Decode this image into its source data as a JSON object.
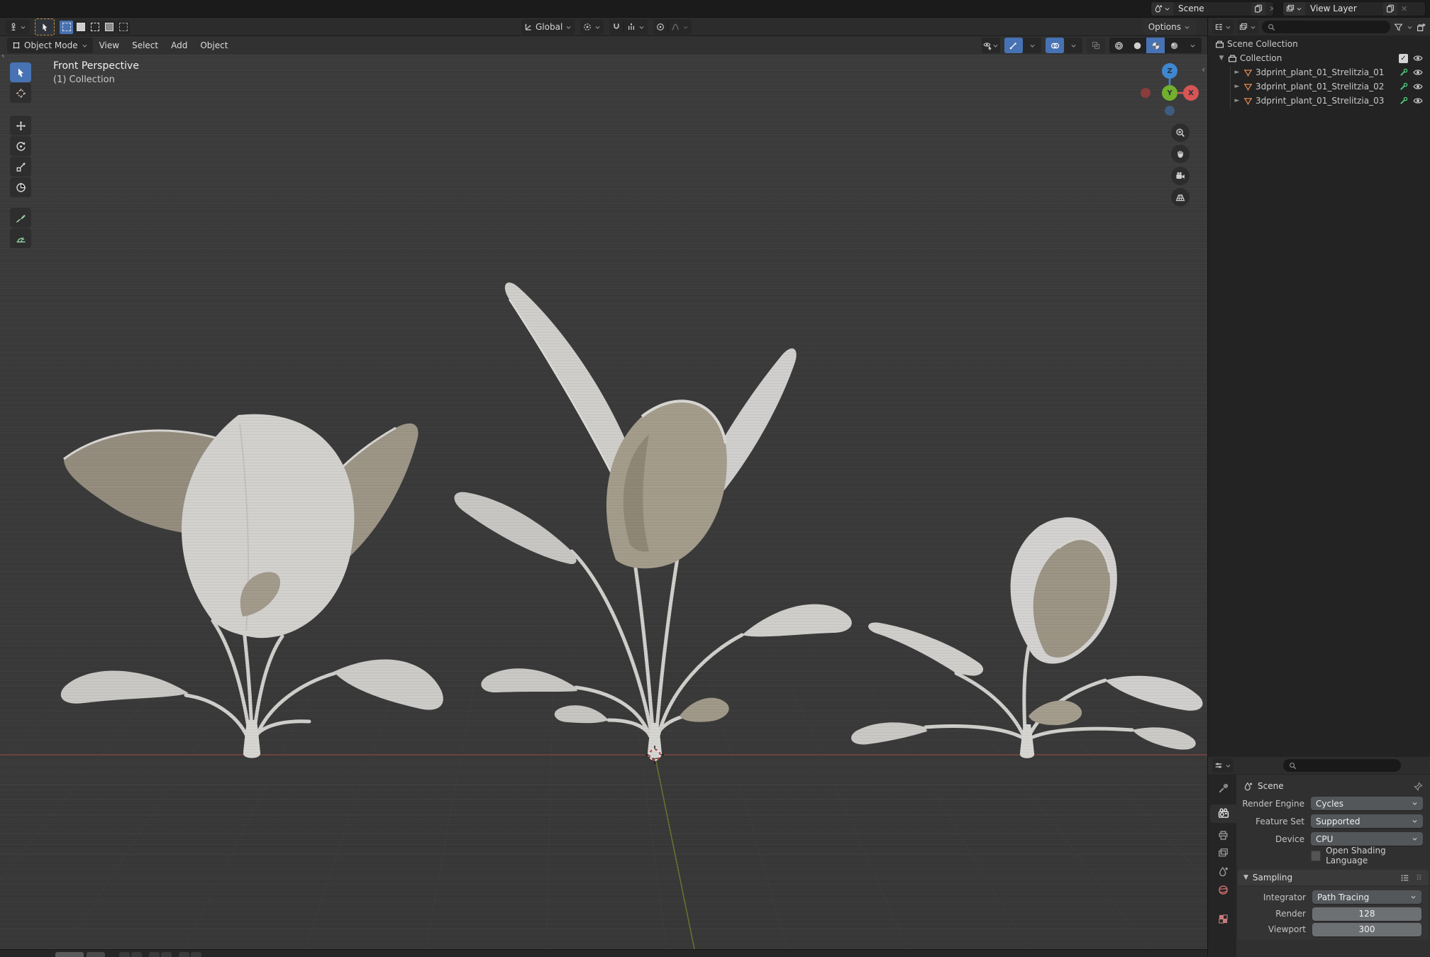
{
  "topbar": {
    "scene": {
      "label": "Scene"
    },
    "view_layer": {
      "label": "View Layer"
    }
  },
  "tool_settings": {
    "orientation_value": "Global",
    "options_label": "Options"
  },
  "viewport": {
    "mode_value": "Object Mode",
    "menu_view": "View",
    "menu_select": "Select",
    "menu_add": "Add",
    "menu_object": "Object",
    "overlay_view": "Front Perspective",
    "overlay_collection": "(1) Collection",
    "axis_x": "X",
    "axis_y": "Y",
    "axis_z": "Z"
  },
  "outliner": {
    "scene_collection": "Scene Collection",
    "collection": "Collection",
    "objects": [
      "3dprint_plant_01_Strelitzia_01",
      "3dprint_plant_01_Strelitzia_02",
      "3dprint_plant_01_Strelitzia_03"
    ]
  },
  "properties": {
    "breadcrumb": "Scene",
    "render_engine": {
      "label": "Render Engine",
      "value": "Cycles"
    },
    "feature_set": {
      "label": "Feature Set",
      "value": "Supported"
    },
    "device": {
      "label": "Device",
      "value": "CPU"
    },
    "osl": {
      "label": "Open Shading Language"
    },
    "sampling": {
      "label": "Sampling"
    },
    "integrator": {
      "label": "Integrator",
      "value": "Path Tracing"
    },
    "render_samples": {
      "label": "Render",
      "value": "128"
    },
    "viewport_samples": {
      "label": "Viewport",
      "value": "300"
    }
  },
  "colors": {
    "accent_blue": "#4772b3",
    "mesh_orange": "#d9864f",
    "modifier_green": "#4ed17e",
    "axis_x_red": "#d75555",
    "axis_y_green": "#72b02e",
    "axis_z_blue": "#3f87d0"
  }
}
